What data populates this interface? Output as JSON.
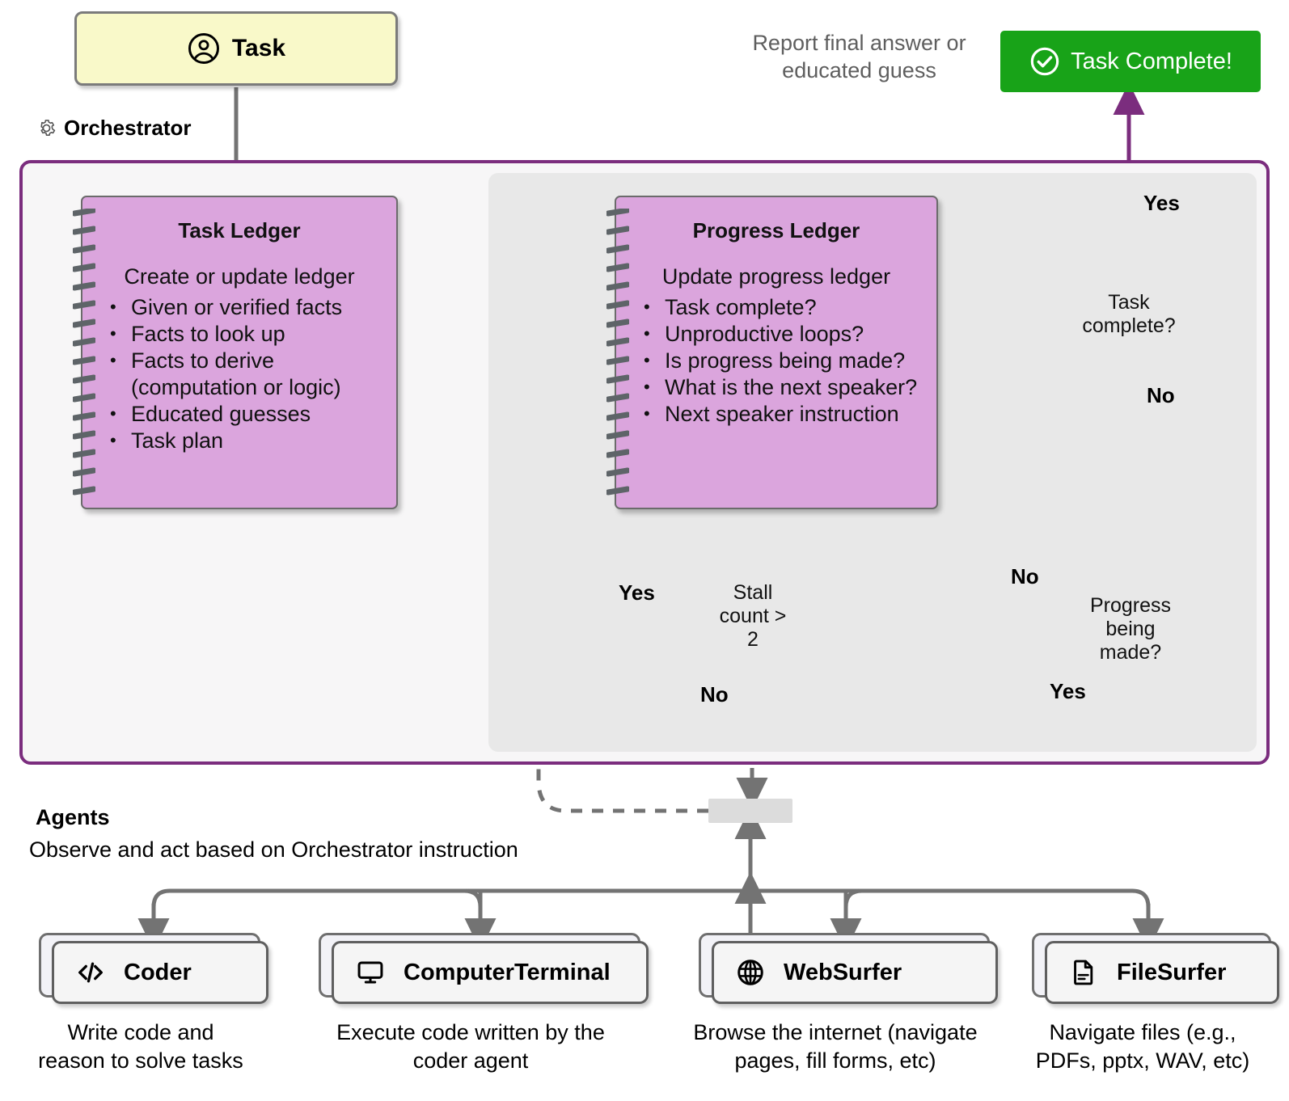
{
  "diagram": {
    "title": "Magentic-One Orchestrator and Agents Flow"
  },
  "task": {
    "label": "Task",
    "icon": "user-circle-icon"
  },
  "task_complete": {
    "label": "Task Complete!",
    "icon": "check-circle-icon"
  },
  "report_note": "Report final answer or educated guess",
  "orchestrator": {
    "label": "Orchestrator",
    "icon": "gear-icon"
  },
  "task_ledger": {
    "title": "Task Ledger",
    "subtitle": "Create or update ledger",
    "items": [
      "Given or verified facts",
      "Facts to look up",
      "Facts to derive (computation or logic)",
      "Educated guesses",
      "Task plan"
    ]
  },
  "progress_ledger": {
    "title": "Progress Ledger",
    "subtitle": "Update progress ledger",
    "items": [
      "Task complete?",
      "Unproductive loops?",
      "Is progress being made?",
      "What is the next speaker?",
      "Next speaker instruction"
    ]
  },
  "decisions": {
    "task_complete": {
      "line1": "Task",
      "line2": "complete?",
      "yes": "Yes",
      "no": "No"
    },
    "progress_made": {
      "line1": "Progress",
      "line2": "being",
      "line3": "made?",
      "yes": "Yes",
      "no": "No"
    },
    "stall_count": {
      "line1": "Stall",
      "line2": "count >",
      "line3": "2",
      "yes": "Yes",
      "no": "No"
    }
  },
  "agents_section": {
    "title": "Agents",
    "subtitle": "Observe and act based on Orchestrator instruction"
  },
  "agents": [
    {
      "name": "Coder",
      "icon": "code-icon",
      "caption": "Write code and reason to solve tasks"
    },
    {
      "name": "ComputerTerminal",
      "icon": "monitor-icon",
      "caption": "Execute code written by the coder agent"
    },
    {
      "name": "WebSurfer",
      "icon": "globe-icon",
      "caption": "Browse the internet (navigate pages, fill forms, etc)"
    },
    {
      "name": "FileSurfer",
      "icon": "document-icon",
      "caption": "Navigate files (e.g., PDFs, pptx, WAV, etc)"
    }
  ],
  "colors": {
    "ledger_fill": "#dba5dd",
    "orchestrator_border": "#7b2d7e",
    "outer_panel": "#f7f6f7",
    "inner_panel": "#e8e8e8",
    "task_fill": "#f9f9c9",
    "complete_fill": "#18a318",
    "arrow_gray": "#737373",
    "arrow_purple": "#7b2d7e"
  }
}
